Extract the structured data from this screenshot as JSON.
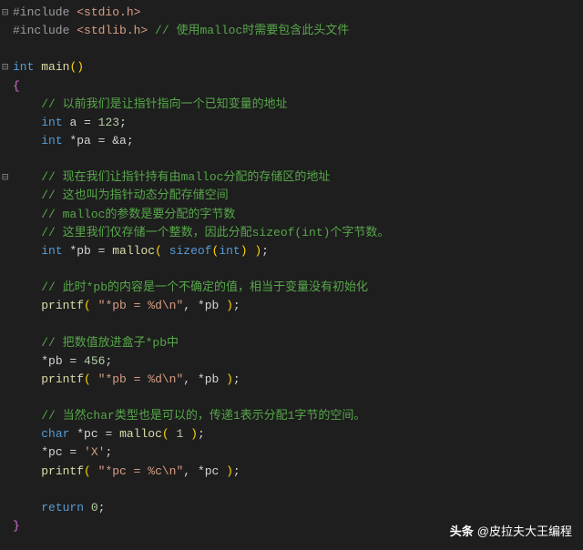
{
  "gutter": [
    "⊟",
    "",
    "",
    "⊟",
    "",
    "",
    "",
    "",
    "",
    "⊟",
    "",
    "",
    "",
    "",
    "",
    "",
    "",
    "",
    "",
    "",
    "",
    "",
    "",
    "",
    "",
    "",
    "",
    "",
    ""
  ],
  "lines": [
    [
      [
        "pp",
        "#include "
      ],
      [
        "inc",
        "<stdio.h>"
      ]
    ],
    [
      [
        "pp",
        "#include "
      ],
      [
        "inc",
        "<stdlib.h>"
      ],
      [
        "punc",
        " "
      ],
      [
        "cmt",
        "// 使用malloc时需要包含此头文件"
      ]
    ],
    [],
    [
      [
        "kw",
        "int"
      ],
      [
        "punc",
        " "
      ],
      [
        "fn",
        "main"
      ],
      [
        "paren",
        "()"
      ]
    ],
    [
      [
        "brace",
        "{"
      ]
    ],
    [
      [
        "punc",
        "    "
      ],
      [
        "cmt",
        "// 以前我们是让指针指向一个已知变量的地址"
      ]
    ],
    [
      [
        "punc",
        "    "
      ],
      [
        "kw",
        "int"
      ],
      [
        "punc",
        " "
      ],
      [
        "ident",
        "a "
      ],
      [
        "punc",
        "= "
      ],
      [
        "num",
        "123"
      ],
      [
        "punc",
        ";"
      ]
    ],
    [
      [
        "punc",
        "    "
      ],
      [
        "kw",
        "int"
      ],
      [
        "punc",
        " *"
      ],
      [
        "ident",
        "pa "
      ],
      [
        "punc",
        "= &"
      ],
      [
        "ident",
        "a"
      ],
      [
        "punc",
        ";"
      ]
    ],
    [],
    [
      [
        "punc",
        "    "
      ],
      [
        "cmt",
        "// 现在我们让指针持有由malloc分配的存储区的地址"
      ]
    ],
    [
      [
        "punc",
        "    "
      ],
      [
        "cmt",
        "// 这也叫为指针动态分配存储空间"
      ]
    ],
    [
      [
        "punc",
        "    "
      ],
      [
        "cmt",
        "// malloc的参数是要分配的字节数"
      ]
    ],
    [
      [
        "punc",
        "    "
      ],
      [
        "cmt",
        "// 这里我们仅存储一个整数，因此分配sizeof(int)个字节数。"
      ]
    ],
    [
      [
        "punc",
        "    "
      ],
      [
        "kw",
        "int"
      ],
      [
        "punc",
        " *"
      ],
      [
        "ident",
        "pb "
      ],
      [
        "punc",
        "= "
      ],
      [
        "fn",
        "malloc"
      ],
      [
        "paren",
        "("
      ],
      [
        "punc",
        " "
      ],
      [
        "kw",
        "sizeof"
      ],
      [
        "paren",
        "("
      ],
      [
        "kw",
        "int"
      ],
      [
        "paren",
        ")"
      ],
      [
        "punc",
        " "
      ],
      [
        "paren",
        ")"
      ],
      [
        "punc",
        ";"
      ]
    ],
    [],
    [
      [
        "punc",
        "    "
      ],
      [
        "cmt",
        "// 此时*pb的内容是一个不确定的值，相当于变量没有初始化"
      ]
    ],
    [
      [
        "punc",
        "    "
      ],
      [
        "fn",
        "printf"
      ],
      [
        "paren",
        "("
      ],
      [
        "punc",
        " "
      ],
      [
        "str",
        "\"*pb = %d\\n\""
      ],
      [
        "punc",
        ", *"
      ],
      [
        "ident",
        "pb"
      ],
      [
        "punc",
        " "
      ],
      [
        "paren",
        ")"
      ],
      [
        "punc",
        ";"
      ]
    ],
    [],
    [
      [
        "punc",
        "    "
      ],
      [
        "cmt",
        "// 把数值放进盒子*pb中"
      ]
    ],
    [
      [
        "punc",
        "    *"
      ],
      [
        "ident",
        "pb "
      ],
      [
        "punc",
        "= "
      ],
      [
        "num",
        "456"
      ],
      [
        "punc",
        ";"
      ]
    ],
    [
      [
        "punc",
        "    "
      ],
      [
        "fn",
        "printf"
      ],
      [
        "paren",
        "("
      ],
      [
        "punc",
        " "
      ],
      [
        "str",
        "\"*pb = %d\\n\""
      ],
      [
        "punc",
        ", *"
      ],
      [
        "ident",
        "pb"
      ],
      [
        "punc",
        " "
      ],
      [
        "paren",
        ")"
      ],
      [
        "punc",
        ";"
      ]
    ],
    [],
    [
      [
        "punc",
        "    "
      ],
      [
        "cmt",
        "// 当然char类型也是可以的，传递1表示分配1字节的空间。"
      ]
    ],
    [
      [
        "punc",
        "    "
      ],
      [
        "kw",
        "char"
      ],
      [
        "punc",
        " *"
      ],
      [
        "ident",
        "pc "
      ],
      [
        "punc",
        "= "
      ],
      [
        "fn",
        "malloc"
      ],
      [
        "paren",
        "("
      ],
      [
        "punc",
        " "
      ],
      [
        "num",
        "1"
      ],
      [
        "punc",
        " "
      ],
      [
        "paren",
        ")"
      ],
      [
        "punc",
        ";"
      ]
    ],
    [
      [
        "punc",
        "    *"
      ],
      [
        "ident",
        "pc "
      ],
      [
        "punc",
        "= "
      ],
      [
        "str",
        "'X'"
      ],
      [
        "punc",
        ";"
      ]
    ],
    [
      [
        "punc",
        "    "
      ],
      [
        "fn",
        "printf"
      ],
      [
        "paren",
        "("
      ],
      [
        "punc",
        " "
      ],
      [
        "str",
        "\"*pc = %c\\n\""
      ],
      [
        "punc",
        ", *"
      ],
      [
        "ident",
        "pc"
      ],
      [
        "punc",
        " "
      ],
      [
        "paren",
        ")"
      ],
      [
        "punc",
        ";"
      ]
    ],
    [],
    [
      [
        "punc",
        "    "
      ],
      [
        "kw",
        "return"
      ],
      [
        "punc",
        " "
      ],
      [
        "num",
        "0"
      ],
      [
        "punc",
        ";"
      ]
    ],
    [
      [
        "brace",
        "}"
      ]
    ]
  ],
  "watermark": {
    "label": "头条",
    "author": "@皮拉夫大王编程"
  }
}
